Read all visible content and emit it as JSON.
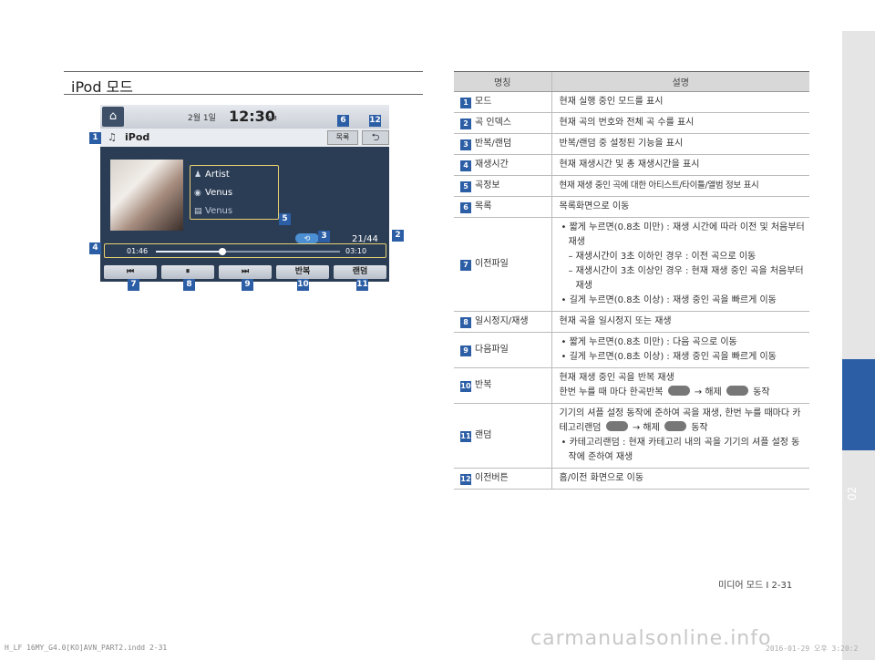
{
  "section": {
    "title": "iPod 모드"
  },
  "screen": {
    "date": "2월  1일",
    "time": "12:30",
    "ampm": "AM",
    "mode": "iPod",
    "list_button": "목록",
    "back_glyph": "⮌",
    "home_glyph": "⌂",
    "artist": "Artist",
    "song": "Venus",
    "album": "Venus",
    "track_count": "21/44",
    "time_start": "01:46",
    "time_end": "03:10",
    "progress": 0.36,
    "buttons": [
      "⏮",
      "⏸",
      "⏭",
      "반복",
      "랜덤"
    ]
  },
  "badges": [
    "1",
    "2",
    "3",
    "4",
    "5",
    "6",
    "7",
    "8",
    "9",
    "10",
    "11",
    "12"
  ],
  "table": {
    "header": {
      "name": "명칭",
      "desc": "설명"
    },
    "rows": [
      {
        "num": "1",
        "name": "모드",
        "lines": [
          "현재 실행 중인 모드를 표시"
        ]
      },
      {
        "num": "2",
        "name": "곡 인덱스",
        "lines": [
          "현재 곡의 번호와 전체 곡 수를 표시"
        ]
      },
      {
        "num": "3",
        "name": "반복/랜덤",
        "lines": [
          "반복/랜덤 중 설정된 기능을 표시"
        ]
      },
      {
        "num": "4",
        "name": "재생시간",
        "lines": [
          "현재 재생시간 및 총 재생시간을 표시"
        ]
      },
      {
        "num": "5",
        "name": "곡정보",
        "lines": [
          "현재 재생 중인 곡에 대한 아티스트/타이틀/앨범 정보 표시"
        ]
      },
      {
        "num": "6",
        "name": "목록",
        "lines": [
          "목록화면으로 이동"
        ]
      },
      {
        "num": "7",
        "name": "이전파일",
        "lines": [
          "• 짧게 누르면(0.8초 미만) : 재생 시간에 따라 이전 및 처음부터 재생",
          "– 재생시간이 3초 이하인 경우 : 이전 곡으로 이동",
          "– 재생시간이 3초 이상인 경우 : 현재 재생 중인 곡을 처음부터 재생",
          "• 길게 누르면(0.8초 이상) : 재생 중인 곡을 빠르게 이동"
        ]
      },
      {
        "num": "8",
        "name": "일시정지/재생",
        "lines": [
          "현재 곡을 일시정지 또는 재생"
        ]
      },
      {
        "num": "9",
        "name": "다음파일",
        "lines": [
          "• 짧게 누르면(0.8초 미만) : 다음 곡으로 이동",
          "• 길게 누르면(0.8초 이상) : 재생 중인 곡을 빠르게 이동"
        ]
      },
      {
        "num": "10",
        "name": "반복",
        "lines": [
          "현재 재생 중인 곡을 반복 재생",
          "한번 누를 때 마다 한곡반복",
          "→ 해제",
          "동작"
        ]
      },
      {
        "num": "11",
        "name": "랜덤",
        "lines": [
          "기기의 셔플 설정 동작에 준하여 곡을 재생, 한번 누를 때마다 카테고리랜덤",
          "→  해제",
          "동작",
          "• 카테고리랜덤 : 현재 카테고리 내의 곡을 기기의 셔플 설정 동작에 준하여 재생"
        ]
      },
      {
        "num": "12",
        "name": "이전버튼",
        "lines": [
          "홈/이전 화면으로 이동"
        ]
      }
    ]
  },
  "sidebar": {
    "chapter": "02"
  },
  "page_number": "미디어 모드 I 2-31",
  "footer": "H_LF 16MY_G4.0[KO]AVN_PART2.indd   2-31",
  "footer_right": "2016-01-29 오후 3:20:2",
  "watermark": "carmanualsonline.info",
  "colors": {
    "badge": "#2c5ea6",
    "screen": "#2b3d55",
    "highlight": "#e8d070"
  }
}
